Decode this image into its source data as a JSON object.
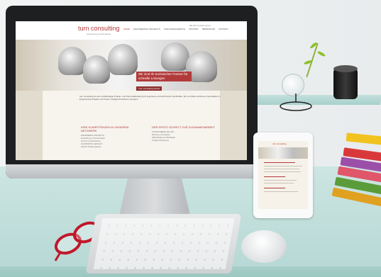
{
  "site": {
    "logo": "turn consulting",
    "logo_sub": "engineering und beratung",
    "top_links": "DE EN  Kontakt  Suche",
    "menu": [
      "HOME",
      "ENGINEERING PROJECTS",
      "STELLENANGEBOTE",
      "KONTAKT",
      "IMPRESSUM",
      "KONTAKT"
    ],
    "hero_headline": "Wir sind Ihr technischer Partner für schnelle Lösungen",
    "hero_sub": "Turn consulting GmbH",
    "intro_text": "turn consulting ist eine unabhängige Projekt- und Personalberatung für Ingenieure und technische Fachkräfte. Wir vermitteln erfahrene Spezialisten in Engineering-Projekte und bieten maßgeschneiderte Lösungen.",
    "col1_heading": "IHRE KOMPETENZEN IN UNSEREM NETZWERK",
    "col1_lines": [
      "ENGINEERING PROJECTS",
      "Entwicklung und Konstruktion",
      "Versuch und Erprobung",
      "FACHKRÄFTE GESUCHT",
      "Aktuelle Stellenangebote"
    ],
    "col2_heading": "DER ERSTE SCHRITT ZUR ZUSAMMENARBEIT",
    "col2_lines": [
      "KONTAKTIEREN SIE UNS",
      "Beratung und Angebot",
      "INDIVIDUELLE LÖSUNGEN",
      "Projektunterstützung"
    ]
  },
  "ipad": {
    "logo": "turn consulting"
  }
}
